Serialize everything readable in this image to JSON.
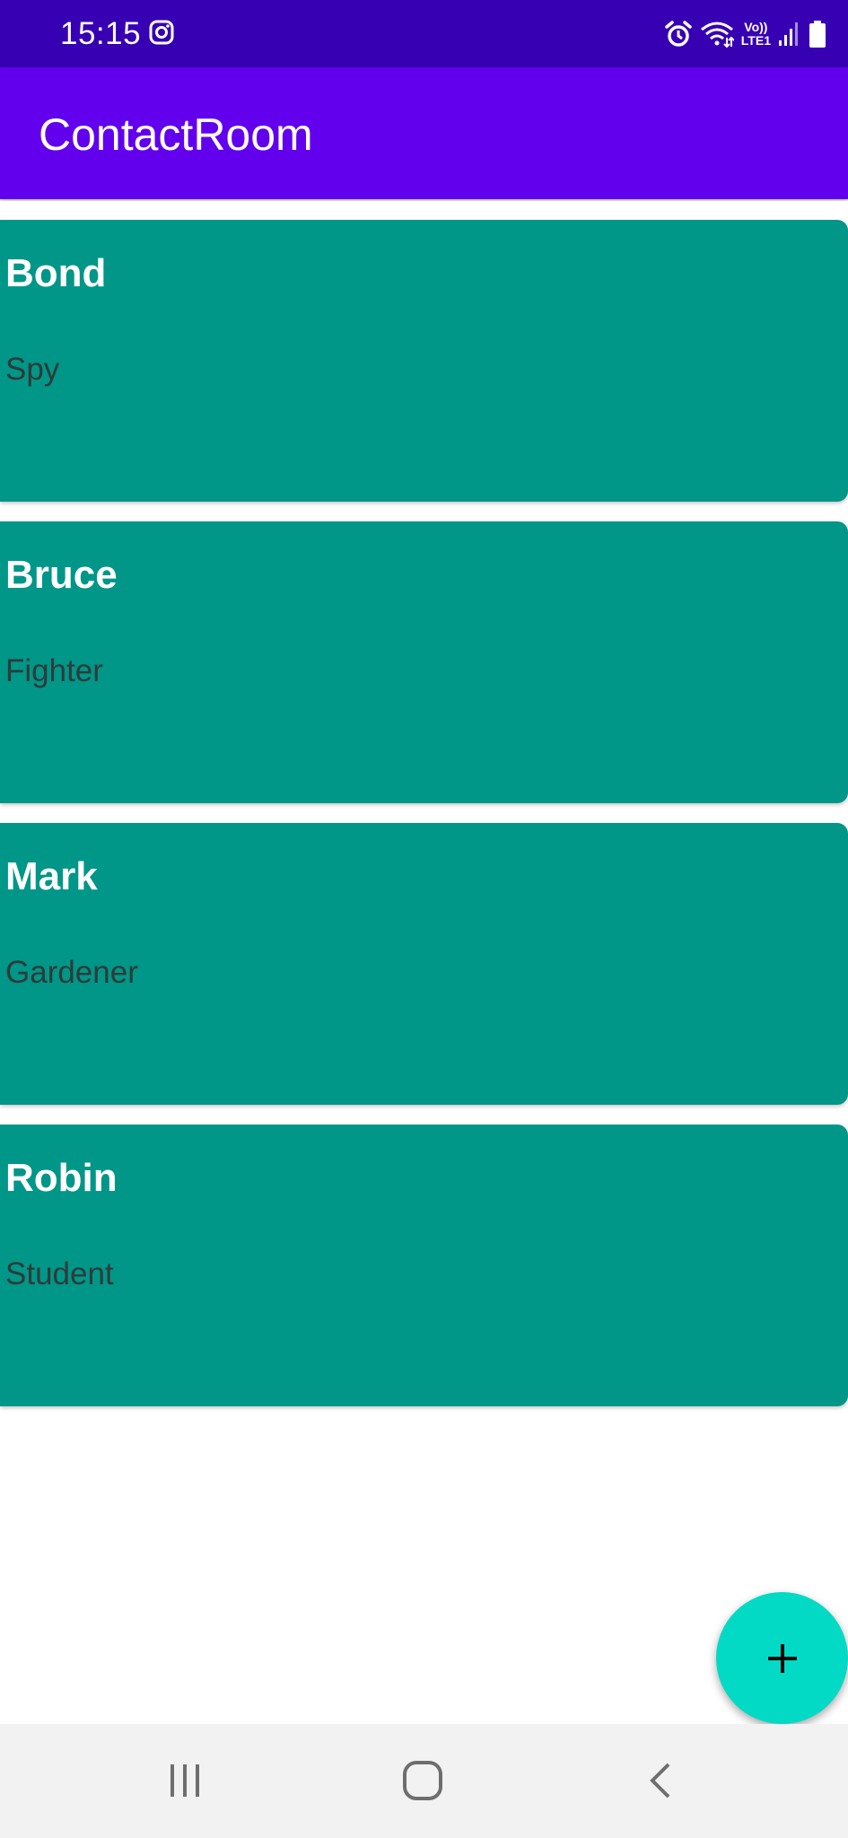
{
  "status_bar": {
    "time": "15:15",
    "lte_top": "Vo))",
    "lte_bottom": "LTE1",
    "icons": [
      "instagram-icon",
      "alarm-icon",
      "wifi-icon",
      "volte-lte-icon",
      "signal-icon",
      "battery-icon"
    ]
  },
  "app_bar": {
    "title": "ContactRoom"
  },
  "contacts": [
    {
      "name": "Bond",
      "occupation": "Spy"
    },
    {
      "name": "Bruce",
      "occupation": "Fighter"
    },
    {
      "name": "Mark",
      "occupation": "Gardener"
    },
    {
      "name": "Robin",
      "occupation": "Student"
    }
  ],
  "fab": {
    "icon": "plus-icon"
  },
  "nav_bar": {
    "icons": [
      "recents-icon",
      "home-icon",
      "back-icon"
    ]
  },
  "colors": {
    "status_bar": "#3700B3",
    "app_bar": "#6200EE",
    "card": "#009688",
    "fab": "#03DAC5",
    "nav_bar": "#F2F2F2"
  }
}
